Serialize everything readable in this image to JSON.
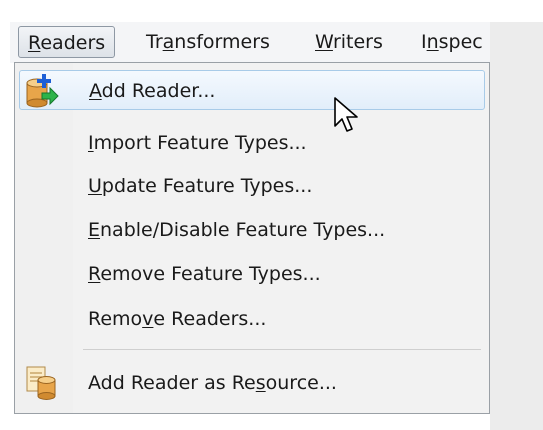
{
  "menubar": {
    "items": [
      {
        "pre": "",
        "key": "R",
        "post": "eaders"
      },
      {
        "pre": "Tr",
        "key": "a",
        "post": "nsformers"
      },
      {
        "pre": "",
        "key": "W",
        "post": "riters"
      },
      {
        "pre": "I",
        "key": "n",
        "post": "spec"
      }
    ]
  },
  "menu": {
    "items": [
      {
        "pre": "",
        "key": "A",
        "post": "dd Reader...",
        "icon": "add-reader-icon"
      },
      {
        "pre": "",
        "key": "I",
        "post": "mport Feature Types..."
      },
      {
        "pre": "",
        "key": "U",
        "post": "pdate Feature Types..."
      },
      {
        "pre": "",
        "key": "E",
        "post": "nable/Disable Feature Types..."
      },
      {
        "pre": "",
        "key": "R",
        "post": "emove Feature Types..."
      },
      {
        "pre": "Remo",
        "key": "v",
        "post": "e Readers..."
      },
      {
        "pre": "Add Reader as Re",
        "key": "s",
        "post": "ource...",
        "icon": "add-reader-resource-icon"
      }
    ]
  },
  "colors": {
    "hover_border": "#a8cbe8",
    "hover_fill": "#e2eefa",
    "menu_bg": "#f2f2f2",
    "icon_cylinder": "#e8a54a",
    "icon_plus": "#1d5fd6",
    "icon_arrow": "#2db34a"
  }
}
